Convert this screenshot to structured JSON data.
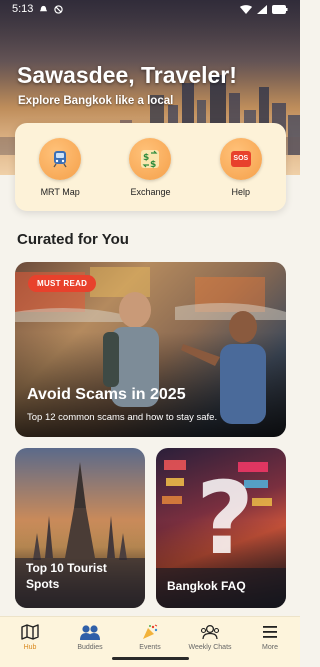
{
  "status_bar": {
    "time": "5:13"
  },
  "hero": {
    "title": "Sawasdee, Traveler!",
    "subtitle": "Explore Bangkok like a local"
  },
  "quick_actions": [
    {
      "label": "MRT Map",
      "icon": "train-icon"
    },
    {
      "label": "Exchange",
      "icon": "currency-exchange-icon"
    },
    {
      "label": "Help",
      "icon": "sos-icon",
      "icon_text": "SOS"
    }
  ],
  "section_title": "Curated for You",
  "feature": {
    "badge": "MUST READ",
    "title": "Avoid Scams in 2025",
    "subtitle": "Top 12 common scams and how to stay safe."
  },
  "grid": {
    "left_title": "Top 10 Tourist Spots",
    "right_title": "Bangkok FAQ",
    "right_mark": "?"
  },
  "bottom_nav": [
    {
      "label": "Hub",
      "icon": "map-icon",
      "active": true
    },
    {
      "label": "Buddies",
      "icon": "people-icon",
      "active": false
    },
    {
      "label": "Events",
      "icon": "party-popper-icon",
      "active": false
    },
    {
      "label": "Weekly Chats",
      "icon": "group-chat-icon",
      "active": false
    },
    {
      "label": "More",
      "icon": "menu-icon",
      "active": false
    }
  ],
  "colors": {
    "accent_orange": "#f5a04a",
    "badge_red": "#e8412c",
    "active_nav": "#d98a20",
    "nav_bg": "#fdf4dc",
    "quick_card_bg": "#fdf2d8"
  }
}
